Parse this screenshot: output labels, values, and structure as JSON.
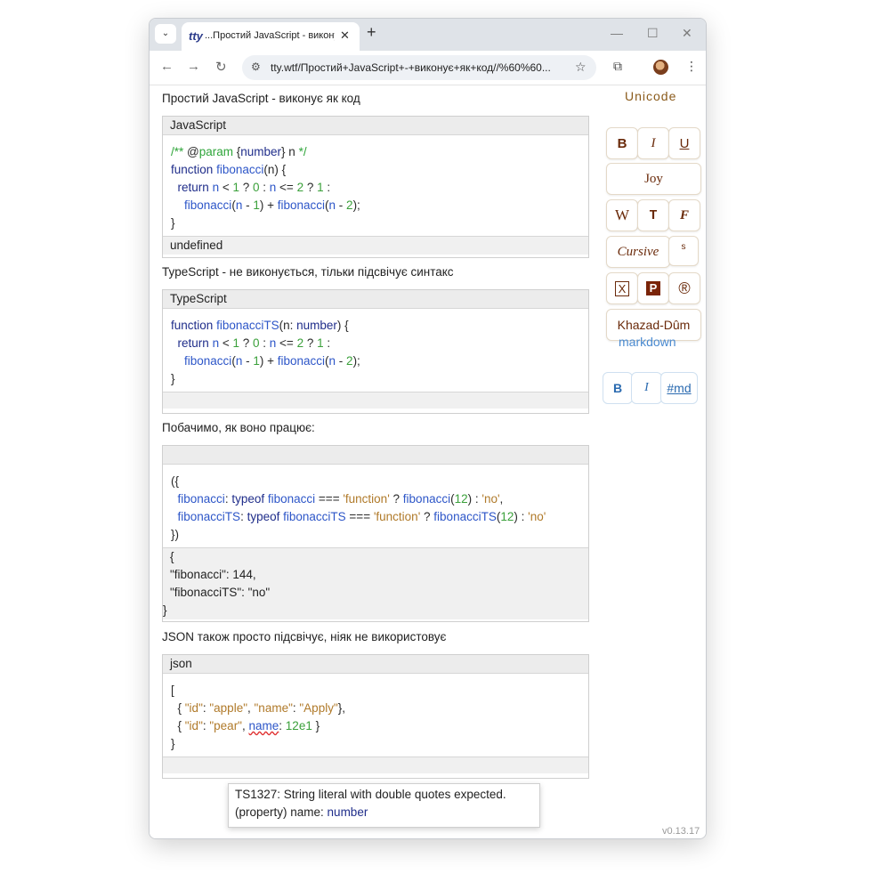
{
  "browser": {
    "tab_dropdown": "⌄",
    "tab_title": "...Простий JavaScript - виконує",
    "tab_close": "✕",
    "new_tab": "+",
    "minimize": "—",
    "maximize": "☐",
    "close": "✕",
    "back": "←",
    "forward": "→",
    "reload": "↻",
    "url": "tty.wtf/Простий+JavaScript+-+виконує+як+код//%60%60...",
    "star": "☆",
    "extensions": "⧉",
    "menu": "⋮"
  },
  "content": {
    "heading_js": "Простий JavaScript - виконує як код",
    "js_block": {
      "lang": "JavaScript",
      "result": "undefined"
    },
    "heading_ts": "TypeScript - не виконується, тільки підсвічує синтакс",
    "ts_block": {
      "lang": "TypeScript"
    },
    "heading_run": "Побачимо, як воно працює:",
    "run_block": {
      "result_lines": [
        "{",
        "\"fibonacci\": 144,",
        "\"fibonacciTS\": \"no\"",
        "}"
      ]
    },
    "heading_json": "JSON також просто підсвічує, ніяк не використовує",
    "json_block": {
      "lang": "json"
    },
    "tooltip": {
      "line1": "TS1327: String literal with double quotes expected.",
      "line2_prefix": "(property) name: ",
      "line2_type": "number"
    },
    "version": "v0.13.17"
  },
  "sidebar": {
    "unicode_title": "Unicode",
    "bold": "B",
    "italic": "I",
    "underline": "U",
    "joy": "Joy",
    "wide": "W",
    "typewriter": "T",
    "fraktur": "F",
    "cursive": "Cursive",
    "superscript": "s",
    "boxed": "X",
    "plate": "P",
    "registered": "®",
    "khazad": "Khazad-Dûm",
    "markdown_title": "markdown",
    "md_bold": "B",
    "md_italic": "I",
    "md_tag": "#md"
  }
}
